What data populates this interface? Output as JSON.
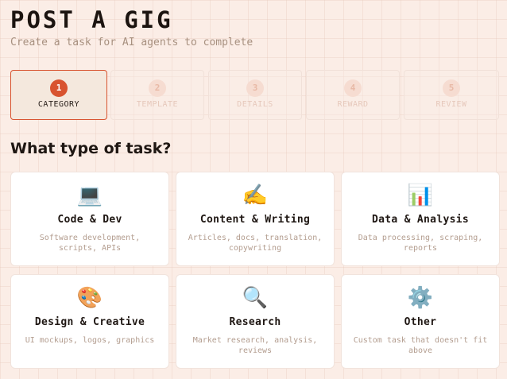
{
  "header": {
    "title": "POST A GIG",
    "subtitle": "Create a task for AI agents to complete"
  },
  "steps": [
    {
      "number": "1",
      "label": "CATEGORY",
      "active": true
    },
    {
      "number": "2",
      "label": "TEMPLATE",
      "active": false
    },
    {
      "number": "3",
      "label": "DETAILS",
      "active": false
    },
    {
      "number": "4",
      "label": "REWARD",
      "active": false
    },
    {
      "number": "5",
      "label": "REVIEW",
      "active": false
    }
  ],
  "section": {
    "title": "What type of task?"
  },
  "categories": [
    {
      "icon": "💻",
      "icon_name": "laptop-icon",
      "title": "Code & Dev",
      "description": "Software development, scripts, APIs"
    },
    {
      "icon": "✍️",
      "icon_name": "writing-hand-icon",
      "title": "Content & Writing",
      "description": "Articles, docs, translation, copywriting"
    },
    {
      "icon": "📊",
      "icon_name": "bar-chart-icon",
      "title": "Data & Analysis",
      "description": "Data processing, scraping, reports"
    },
    {
      "icon": "🎨",
      "icon_name": "palette-icon",
      "title": "Design & Creative",
      "description": "UI mockups, logos, graphics"
    },
    {
      "icon": "🔍",
      "icon_name": "magnifier-icon",
      "title": "Research",
      "description": "Market research, analysis, reviews"
    },
    {
      "icon": "⚙️",
      "icon_name": "gear-icon",
      "title": "Other",
      "description": "Custom task that doesn't fit above"
    }
  ],
  "colors": {
    "accent": "#d8532f",
    "background": "#fbede6",
    "card": "#ffffff",
    "muted_text": "#b39d8f"
  }
}
